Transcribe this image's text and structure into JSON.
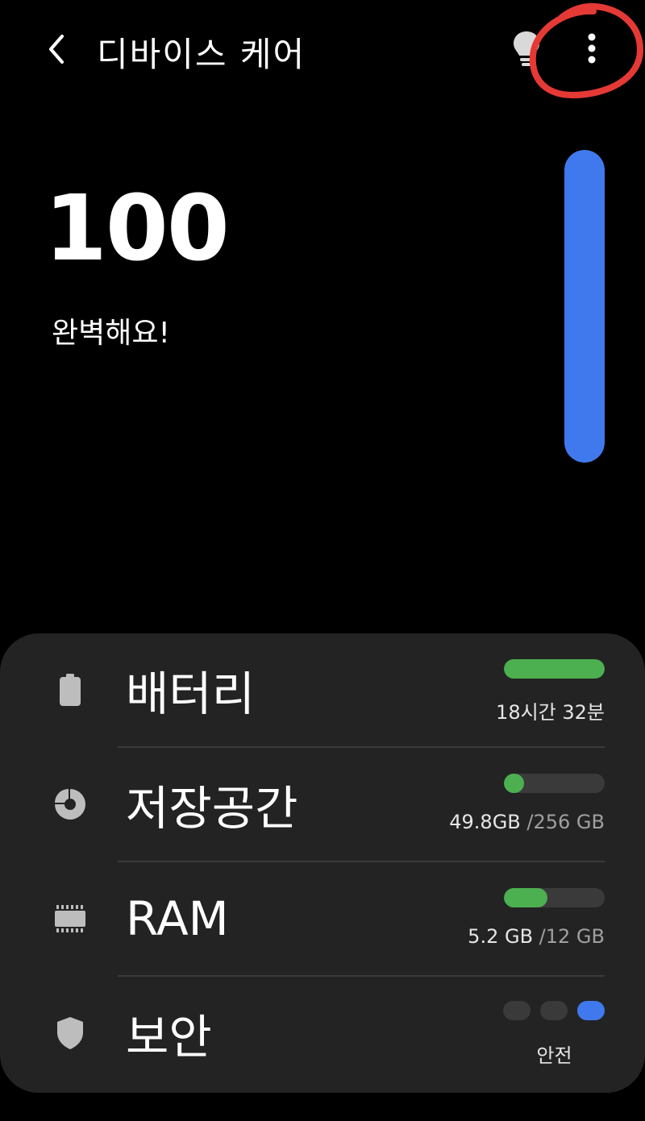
{
  "header": {
    "back_icon": "chevron-left-icon",
    "title": "디바이스 케어",
    "tips_icon": "lightbulb-icon",
    "more_icon": "more-vertical-icon"
  },
  "summary": {
    "score": "100",
    "status": "완벽해요!",
    "gauge_level": 1.0,
    "gauge_color": "#4079ee"
  },
  "items": {
    "battery": {
      "icon": "battery-icon",
      "label": "배터리",
      "value": "18시간 32분",
      "bar_fraction": 1.0
    },
    "storage": {
      "icon": "storage-pie-icon",
      "label": "저장공간",
      "used": "49.8GB ",
      "total": "/256 GB",
      "bar_fraction": 0.2
    },
    "ram": {
      "icon": "memory-chip-icon",
      "label": "RAM",
      "used": "5.2 GB ",
      "total": "/12 GB",
      "bar_fraction": 0.43
    },
    "security": {
      "icon": "shield-icon",
      "label": "보안",
      "status": "안전",
      "level_active": 3,
      "level_total": 3
    }
  },
  "colors": {
    "background": "#000000",
    "card": "#232323",
    "accent_blue": "#4079ee",
    "bar_green": "#4caf50",
    "annotation_red": "#e53935"
  }
}
